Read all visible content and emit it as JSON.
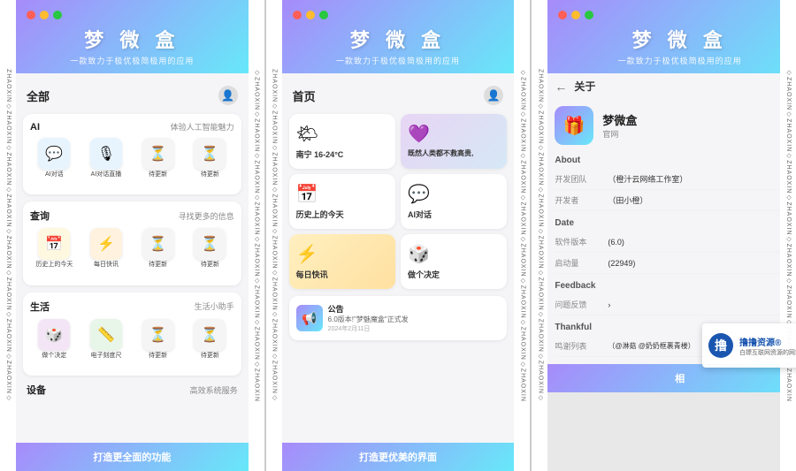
{
  "watermark": {
    "left_text": "ZHAOXIN◇ZHAOXIN◇ZHAOXIN◇ZHAOXIN◇ZHAOXIN◇ZHAOXIN◇ZHAOXIN◇ZHAOXIN◇",
    "right_text": "◇ZHAOXIN◇ZHAOXIN◇ZHAOXIN◇ZHAOXIN◇ZHAOXIN◇ZHAOXIN◇ZHAOXIN◇ZHAOXIN"
  },
  "app": {
    "title": "梦 微 盒",
    "subtitle": "一款致力于极优极简极用的应用"
  },
  "panel1": {
    "traffic": [
      "red",
      "yellow",
      "green"
    ],
    "title": "梦 微 盒",
    "subtitle": "一款致力于极优极简极用的应用",
    "page_title": "全部",
    "footer": "打造更全面的功能",
    "sections": [
      {
        "title": "AI",
        "subtitle": "体验人工智能魅力",
        "items": [
          {
            "label": "AI对话",
            "icon": "💬",
            "bg": "#e8f4fd"
          },
          {
            "label": "AI对话直播",
            "icon": "🎙",
            "bg": "#e8f4fd"
          },
          {
            "label": "待更新",
            "icon": "⏳",
            "bg": "#f5f5f5"
          },
          {
            "label": "待更新",
            "icon": "⏳",
            "bg": "#f5f5f5"
          }
        ]
      },
      {
        "title": "查询",
        "subtitle": "寻找更多的信息",
        "items": [
          {
            "label": "历史上的今天",
            "icon": "📅",
            "bg": "#fff8e1"
          },
          {
            "label": "每日快讯",
            "icon": "⚡",
            "bg": "#fff3e0"
          },
          {
            "label": "待更新",
            "icon": "⏳",
            "bg": "#f5f5f5"
          },
          {
            "label": "待更新",
            "icon": "⏳",
            "bg": "#f5f5f5"
          }
        ]
      },
      {
        "title": "生活",
        "subtitle": "生活小助手",
        "items": [
          {
            "label": "做个决定",
            "icon": "🎲",
            "bg": "#f3e5f5"
          },
          {
            "label": "电子刻度尺",
            "icon": "📏",
            "bg": "#e8f5e9"
          },
          {
            "label": "待更新",
            "icon": "⏳",
            "bg": "#f5f5f5"
          },
          {
            "label": "待更新",
            "icon": "⏳",
            "bg": "#f5f5f5"
          }
        ]
      }
    ],
    "device_section": {
      "title": "设备",
      "subtitle": "高效系统服务"
    }
  },
  "panel2": {
    "title": "梦 微 盒",
    "subtitle": "一款致力于极优极简极用的应用",
    "page_title": "首页",
    "footer": "打造更优美的界面",
    "cards": [
      {
        "label": "南宁 16-24°C",
        "icon": "🌤",
        "sublabel": ""
      },
      {
        "label": "既然人类都不救高贵,",
        "icon": "💜",
        "sublabel": ""
      },
      {
        "label": "历史上的今天",
        "icon": "📅",
        "sublabel": ""
      },
      {
        "label": "AI对话",
        "icon": "💬",
        "sublabel": ""
      },
      {
        "label": "每日快讯",
        "icon": "⚡",
        "sublabel": ""
      },
      {
        "label": "做个决定",
        "icon": "🎲",
        "sublabel": ""
      }
    ],
    "announcement": {
      "title": "公告",
      "body": "6.0版本!\"梦魅魔盒\"正式发",
      "date": "2024年2月11日"
    }
  },
  "panel3": {
    "title": "梦 微 盒",
    "subtitle": "一款致力于极优极简极用的应用",
    "back_label": "←  关于",
    "footer": "相",
    "app_name": "梦微盒",
    "app_site": "官网",
    "sections": {
      "about_title": "About",
      "about_rows": [
        {
          "label": "开发团队",
          "value": "（橙汁云网络工作室）"
        },
        {
          "label": "开发者",
          "value": "（田小橙）"
        }
      ],
      "date_title": "Date",
      "date_rows": [
        {
          "label": "软件版本",
          "value": "(6.0)"
        },
        {
          "label": "启动量",
          "value": "(22949)"
        }
      ],
      "feedback_title": "Feedback",
      "feedback_rows": [
        {
          "label": "问题反馈",
          "value": ""
        }
      ],
      "thankful_title": "Thankful",
      "thankful_rows": [
        {
          "label": "鸣谢列表",
          "value": "（@淋菇   @奶奶框裹青楼）"
        }
      ]
    }
  },
  "brand": {
    "name": "撸撸资源®",
    "sub": "白嫖互联网资源的网站"
  }
}
